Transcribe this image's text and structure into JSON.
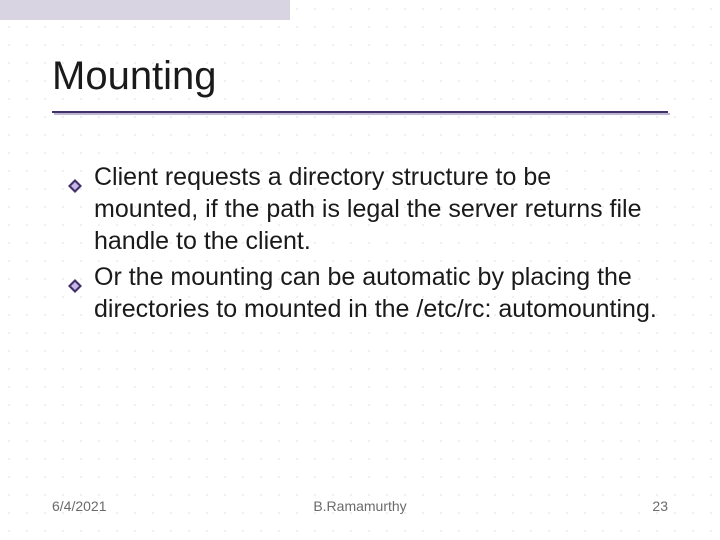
{
  "title": "Mounting",
  "bullets": [
    "Client requests a directory structure to be mounted, if the path is legal the server returns file handle to the client.",
    "Or the mounting can be automatic by placing the directories to mounted in the /etc/rc: automounting."
  ],
  "footer": {
    "date": "6/4/2021",
    "author": "B.Ramamurthy",
    "page": "23"
  },
  "colors": {
    "accent": "#41306a",
    "accent_light": "#bdb4cf"
  }
}
